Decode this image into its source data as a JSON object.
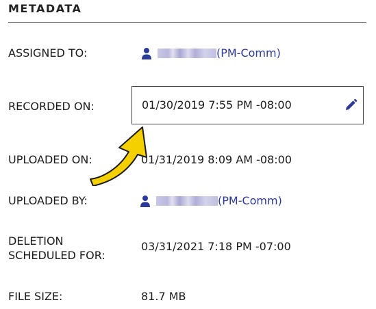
{
  "metadata": {
    "title": "METADATA",
    "rows": [
      {
        "label": "ASSIGNED TO:",
        "user_role": "(PM-Comm)"
      },
      {
        "label": "RECORDED ON:",
        "value": "01/30/2019 7:55 PM -08:00"
      },
      {
        "label": "UPLOADED ON:",
        "value": "01/31/2019 8:09 AM -08:00"
      },
      {
        "label": "UPLOADED BY:",
        "user_role": "(PM-Comm)"
      },
      {
        "label_line1": "DELETION",
        "label_line2": "SCHEDULED FOR:",
        "value": "03/31/2021 7:18 PM -07:00"
      },
      {
        "label": "FILE SIZE:",
        "value": "81.7 MB"
      }
    ]
  },
  "icons": {
    "person": "person-icon",
    "edit": "pencil-icon",
    "annotation": "curved-arrow"
  },
  "colors": {
    "link": "#2c3a97",
    "arrow_fill": "#f5d000",
    "arrow_stroke": "#1a1a1a"
  }
}
